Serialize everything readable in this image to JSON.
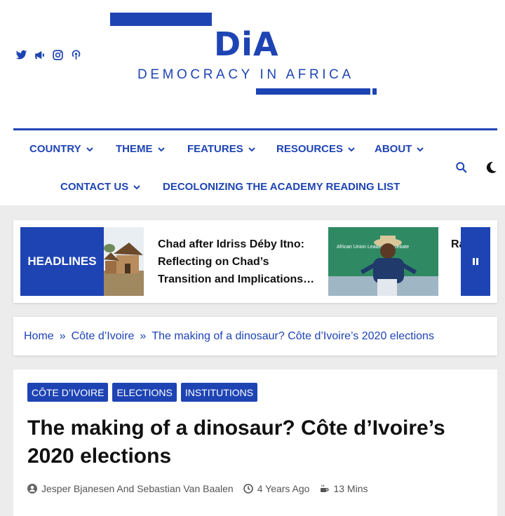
{
  "brand": {
    "title": "DiA",
    "subtitle": "DEMOCRACY IN AFRICA",
    "color": "#1e44b4"
  },
  "social": [
    "twitter-icon",
    "megaphone-icon",
    "instagram-icon",
    "podcast-icon"
  ],
  "nav": {
    "items": [
      {
        "label": "COUNTRY"
      },
      {
        "label": "THEME"
      },
      {
        "label": "FEATURES"
      },
      {
        "label": "RESOURCES"
      },
      {
        "label": "ABOUT"
      },
      {
        "label": "CONTACT US"
      },
      {
        "label": "DECOLONIZING THE ACADEMY READING LIST"
      }
    ]
  },
  "headlines": {
    "label": "HEADLINES",
    "items": [
      {
        "title": "Chad after Idriss Déby Itno: Reflecting on Chad’s Transition and Implications…"
      },
      {
        "title": "Ra… Ch… on…"
      }
    ],
    "image2_caption": "African Union Leadership Debate"
  },
  "breadcrumb": {
    "items": [
      "Home",
      "Côte d’Ivoire",
      "The making of a dinosaur? Côte d’Ivoire’s 2020 elections"
    ]
  },
  "article": {
    "tags": [
      "CÔTE D’IVOIRE",
      "ELECTIONS",
      "INSTITUTIONS"
    ],
    "title": "The making of a dinosaur? Côte d’Ivoire’s 2020 elections",
    "author": "Jesper Bjanesen And Sebastian Van Baalen",
    "date": "4 Years Ago",
    "read_time": "13 Mins"
  }
}
